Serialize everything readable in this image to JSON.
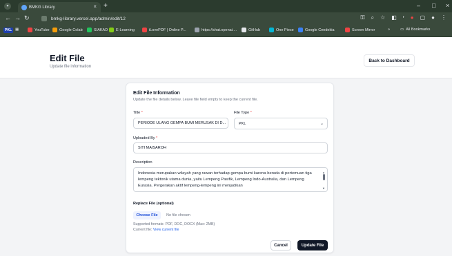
{
  "browser": {
    "tab_title": "BMKG Library",
    "url": "bmkg-library.vercel.app/admin/edit/12",
    "bookmarks": [
      "YouTube",
      "Google Colab",
      "SIAKAD",
      "E-Learning",
      "iLovePDF | Online P...",
      "https://chat.openai....",
      "GitHub",
      "One Piece",
      "Google Cendekia",
      "Screen Mirror"
    ],
    "bookmarks_folder": "All Bookmarks",
    "pkl_badge": "PKL"
  },
  "header": {
    "title": "Edit File",
    "subtitle": "Update file information",
    "back_button": "Back to Dashboard"
  },
  "form": {
    "title": "Edit File Information",
    "description": "Update the file details below. Leave file field empty to keep the current file.",
    "title_label": "Title",
    "title_value": "PERIODE ULANG GEMPA BUMI MERUSAK DI D...",
    "file_type_label": "File Type",
    "file_type_value": "PKL",
    "uploaded_by_label": "Uploaded By",
    "uploaded_by_value": "SITI MAISAROH",
    "description_label": "Description",
    "description_value": "Indonesia merupakan wilayah yang rawan terhadap gempa bumi karena berada di pertemuan tiga lempeng tektonik utama dunia, yaitu Lempeng Pasifik, Lempeng Indo-Australia, dan Lempeng Eurasia. Pergerakan aktif lempeng-lempeng ini menjadikan",
    "required_mark": "*",
    "replace_label": "Replace File (optional)",
    "choose_file": "Choose File",
    "no_file": "No file chosen",
    "supported": "Supported formats: PDF, DOC, DOCX (Max: 2MB)",
    "current_file_prefix": "Current file:",
    "current_file_link": "View current file",
    "cancel": "Cancel",
    "update": "Update File"
  }
}
